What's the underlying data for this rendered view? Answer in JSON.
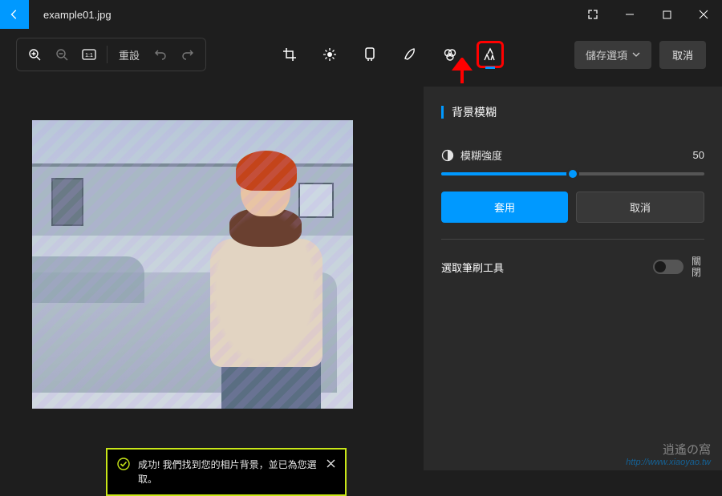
{
  "titlebar": {
    "filename": "example01.jpg"
  },
  "toolbar": {
    "reset_label": "重設"
  },
  "actions": {
    "save_label": "儲存選項",
    "cancel_label": "取消"
  },
  "panel": {
    "title": "背景模糊",
    "slider": {
      "label": "模糊強度",
      "value": "50",
      "percent": 50
    },
    "apply_label": "套用",
    "cancel_label": "取消",
    "brush_label": "選取筆刷工具",
    "toggle_state": "關閉"
  },
  "toast": {
    "text": "成功! 我們找到您的相片背景，並已為您選取。"
  },
  "watermark": {
    "top": "逍遙の窩",
    "bot": "http://www.xiaoyao.tw"
  },
  "chart_data": null
}
